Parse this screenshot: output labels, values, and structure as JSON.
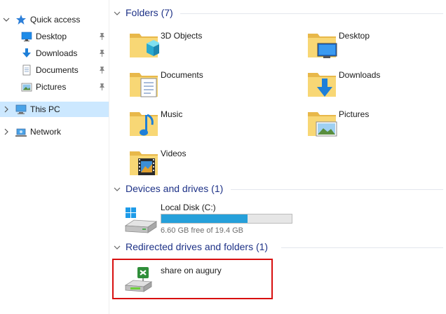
{
  "nav": {
    "quick_access": "Quick access",
    "quick_items": [
      {
        "label": "Desktop",
        "icon": "desktop-icon",
        "pinned": true
      },
      {
        "label": "Downloads",
        "icon": "downloads-icon",
        "pinned": true
      },
      {
        "label": "Documents",
        "icon": "documents-icon",
        "pinned": true
      },
      {
        "label": "Pictures",
        "icon": "pictures-icon",
        "pinned": true
      }
    ],
    "this_pc": "This PC",
    "network": "Network"
  },
  "groups": {
    "folders": {
      "title": "Folders (7)",
      "items": [
        "3D Objects",
        "Desktop",
        "Documents",
        "Downloads",
        "Music",
        "Pictures",
        "Videos"
      ]
    },
    "devices": {
      "title": "Devices and drives (1)",
      "drive": {
        "name": "Local Disk (C:)",
        "free_text": "6.60 GB free of 19.4 GB",
        "used_fraction": 0.66
      }
    },
    "redirected": {
      "title": "Redirected drives and folders (1)",
      "share": "share on augury"
    }
  },
  "colors": {
    "selected_bg": "#cce8ff",
    "header_text": "#1e3287",
    "progress_fill": "#26a0da",
    "highlight_border": "#d80f0f",
    "folder_yellow": "#f8d775"
  }
}
